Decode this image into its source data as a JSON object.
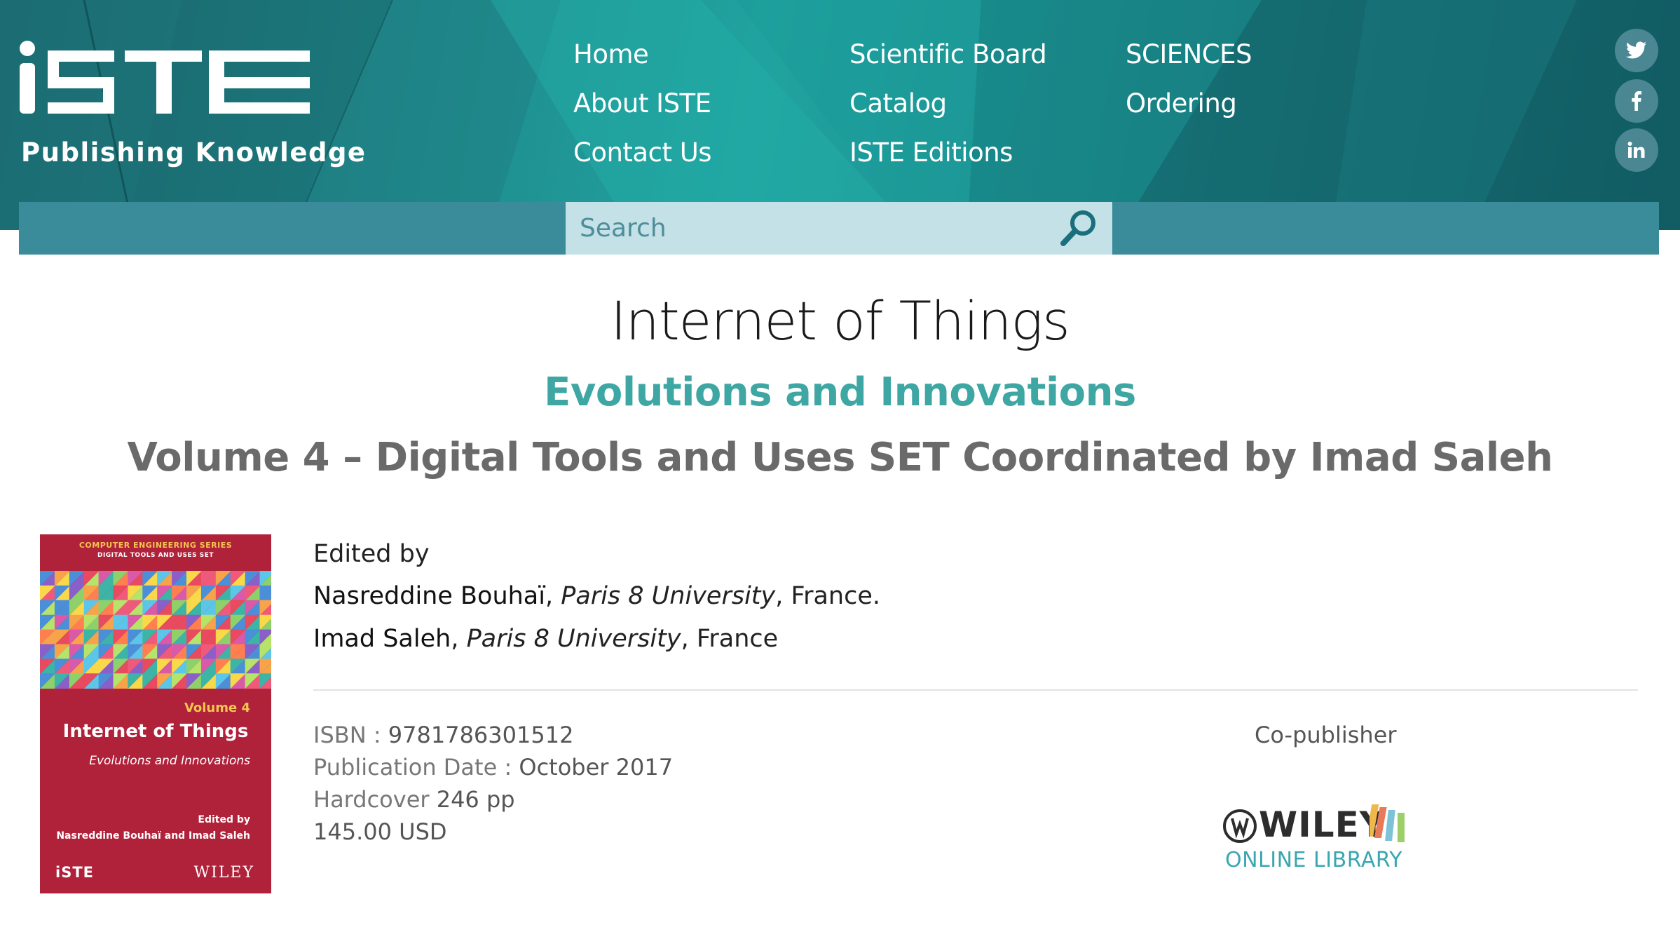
{
  "header": {
    "logo_text": "iSTE",
    "tagline": "Publishing Knowledge",
    "nav": {
      "home": "Home",
      "about": "About ISTE",
      "contact": "Contact Us",
      "board": "Scientific Board",
      "catalog": "Catalog",
      "editions": "ISTE Editions",
      "sciences": "SCIENCES",
      "ordering": "Ordering"
    },
    "social": [
      "twitter-icon",
      "facebook-icon",
      "linkedin-icon"
    ],
    "search": {
      "placeholder": "Search"
    }
  },
  "book": {
    "title": "Internet of Things",
    "subtitle": "Evolutions and Innovations",
    "volume_line": "Volume 4 – Digital Tools and Uses SET Coordinated by Imad Saleh",
    "edited_by_label": "Edited by",
    "editors": [
      {
        "name": "Nasreddine Bouhaï",
        "affiliation": "Paris 8 University",
        "country": ", France."
      },
      {
        "name": "Imad Saleh",
        "affiliation": "Paris 8 University",
        "country": ", France"
      }
    ],
    "isbn_label": "ISBN : ",
    "isbn": "9781786301512",
    "pubdate_label": "Publication Date : ",
    "pubdate": "October 2017",
    "format_label": "Hardcover ",
    "pages": "246 pp",
    "price": "145.00 USD",
    "copublisher_label": "Co-publisher"
  },
  "cover": {
    "series": "COMPUTER ENGINEERING SERIES",
    "set": "DIGITAL TOOLS AND USES SET",
    "volume": "Volume 4",
    "title": "Internet of Things",
    "subtitle": "Evolutions and Innovations",
    "edited_by": "Edited by",
    "editors": "Nasreddine Bouhaï and Imad Saleh",
    "logo_left": "iSTE",
    "logo_right": "WILEY"
  },
  "copublisher_logo": {
    "brand": "WILEY",
    "line": "ONLINE LIBRARY"
  },
  "colors": {
    "accent": "#3fa7a3",
    "header_bg": "#1f8a8c",
    "cover_bg": "#b0213a",
    "search_bg": "#c3e1e6"
  }
}
